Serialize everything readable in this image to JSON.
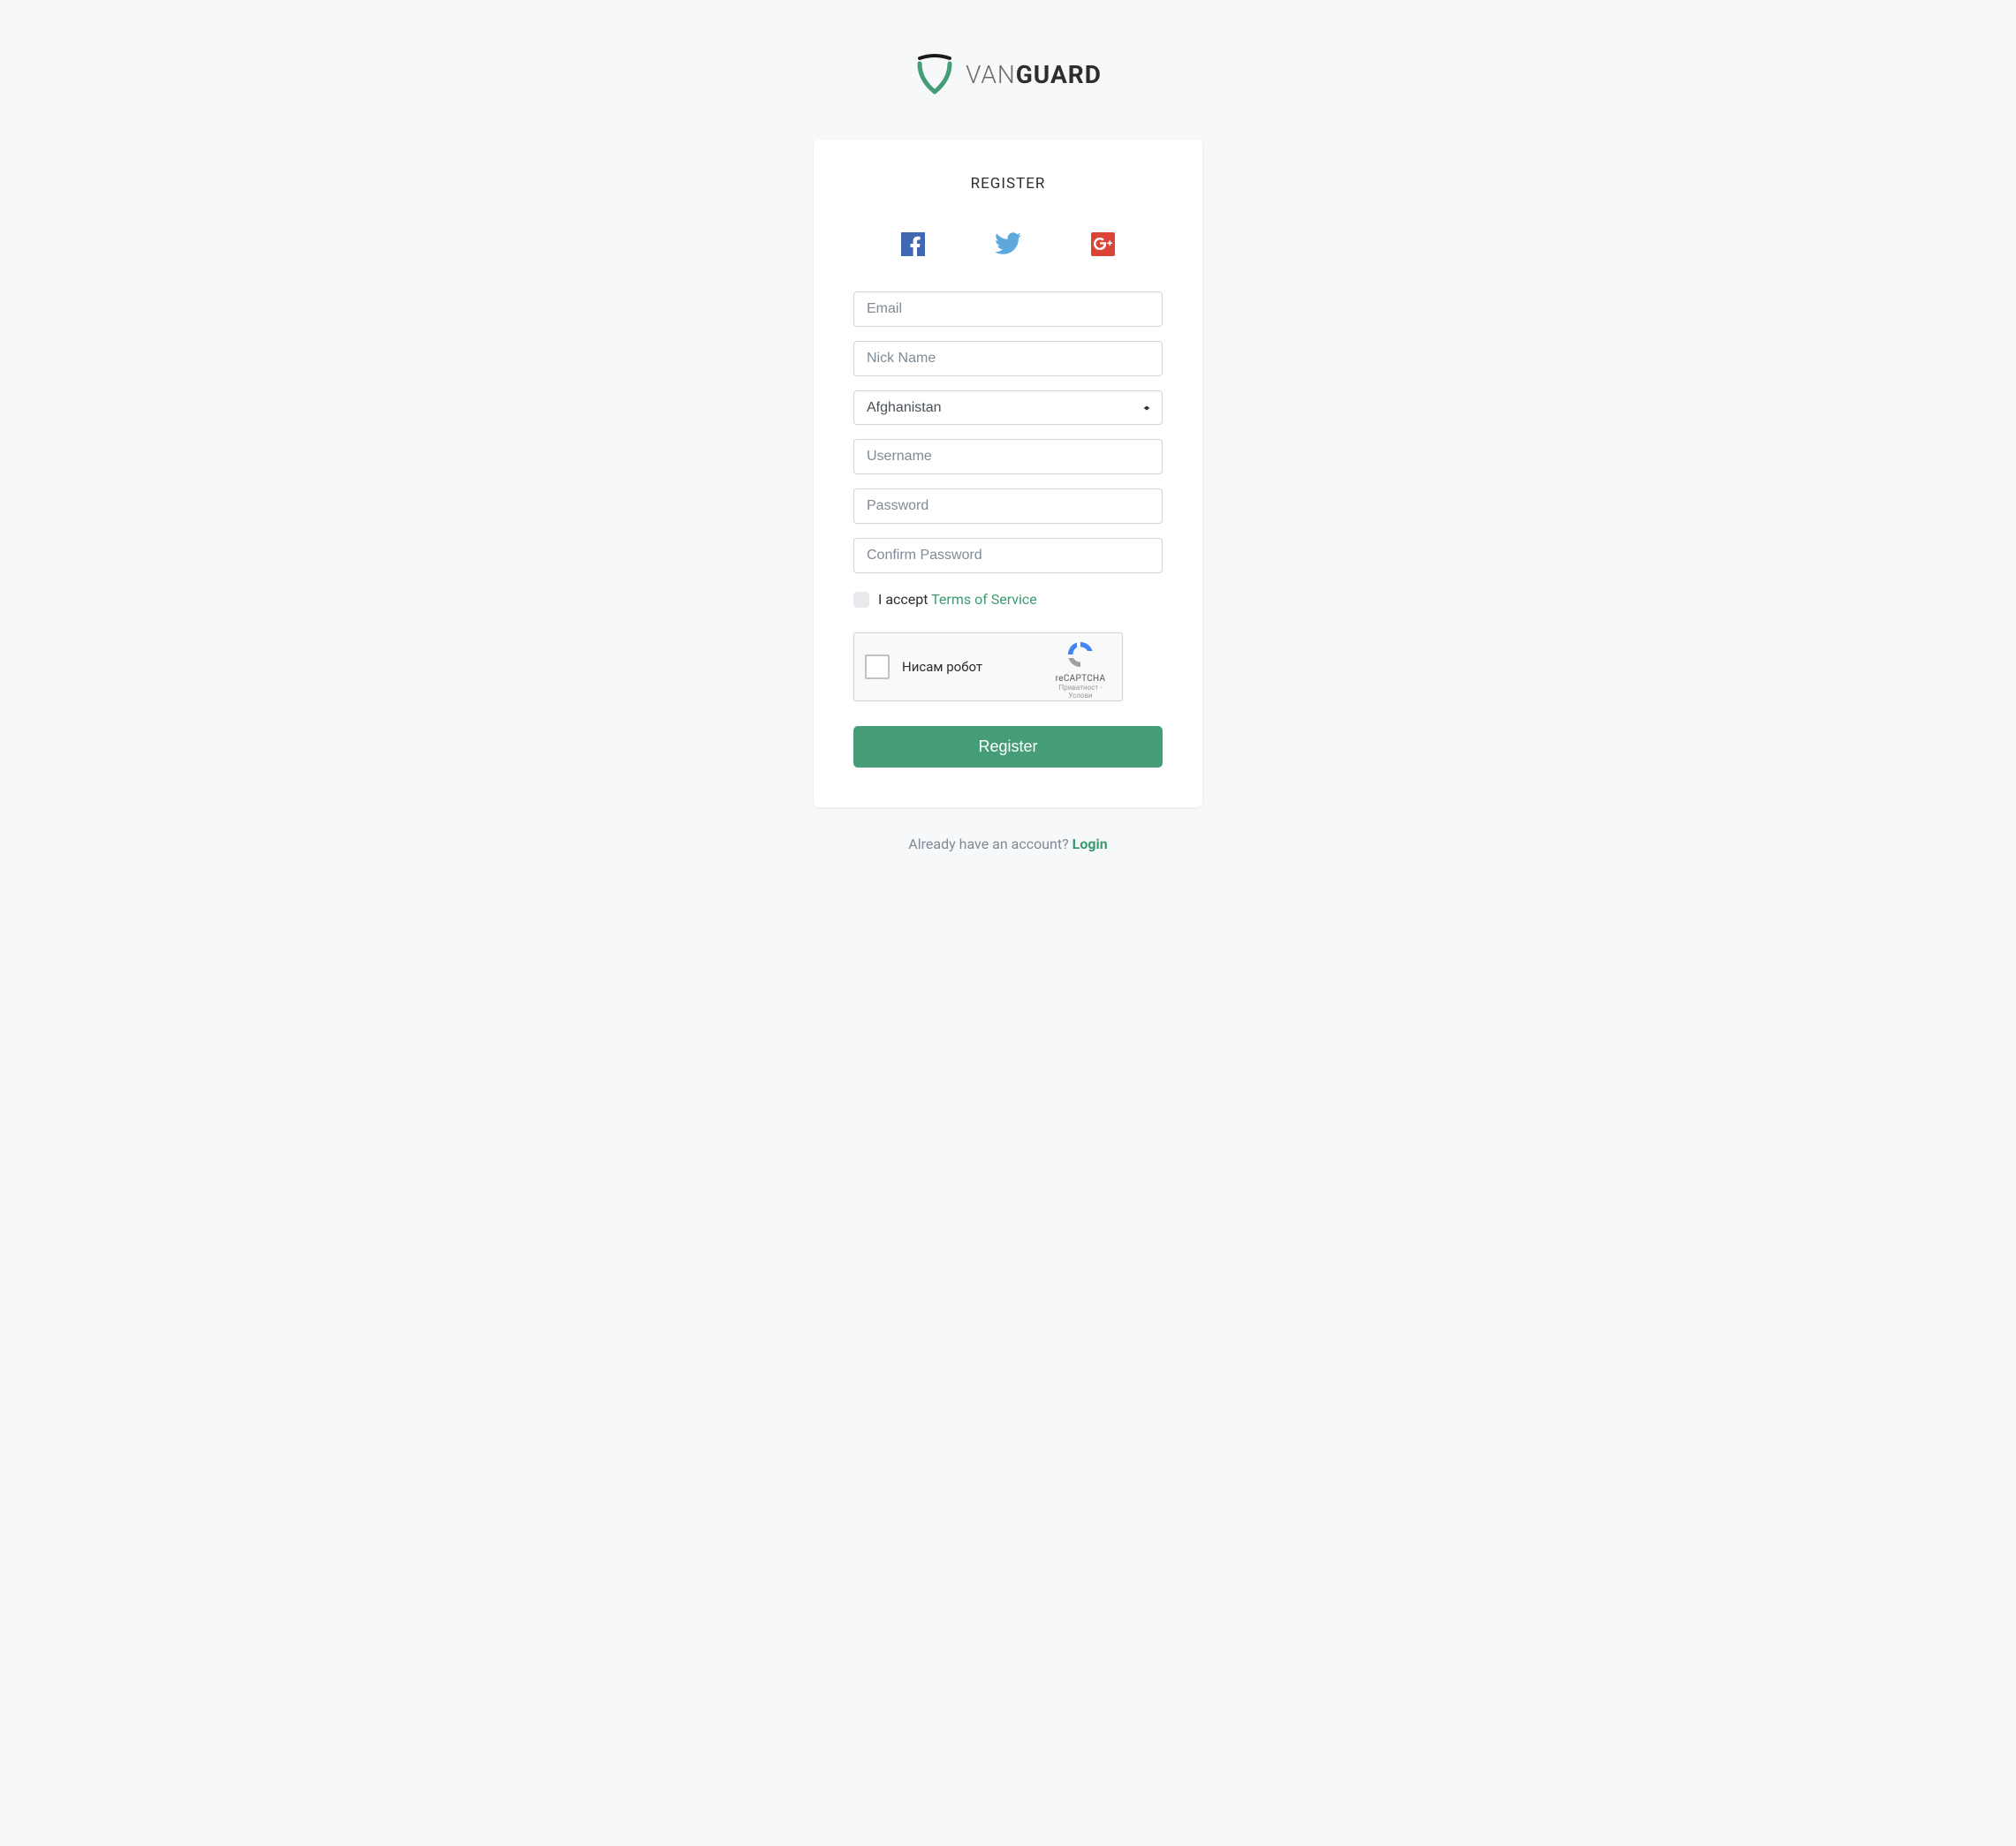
{
  "logo": {
    "text_light": "VAN",
    "text_bold": "GUARD"
  },
  "card": {
    "title": "REGISTER"
  },
  "social": {
    "facebook": "facebook-icon",
    "twitter": "twitter-icon",
    "googleplus": "google-plus-icon"
  },
  "form": {
    "email_placeholder": "Email",
    "nickname_placeholder": "Nick Name",
    "country_selected": "Afghanistan",
    "username_placeholder": "Username",
    "password_placeholder": "Password",
    "confirm_password_placeholder": "Confirm Password"
  },
  "tos": {
    "prefix": "I accept ",
    "link_text": "Terms of Service"
  },
  "recaptcha": {
    "label": "Нисам робот",
    "brand": "reCAPTCHA",
    "links": "Приватност - Услови"
  },
  "buttons": {
    "register": "Register"
  },
  "footer": {
    "prompt": "Already have an account? ",
    "login_link": "Login"
  },
  "colors": {
    "brand_green": "#449d76",
    "link_green": "#3a9b6f",
    "facebook_blue": "#4267B2",
    "twitter_blue": "#1DA1F2",
    "google_red": "#DB4437"
  }
}
